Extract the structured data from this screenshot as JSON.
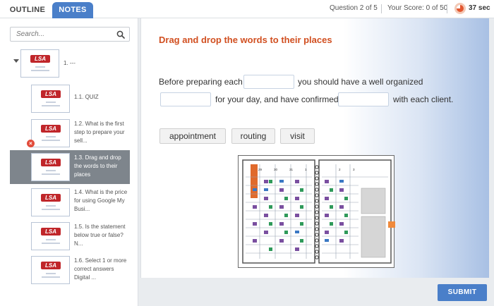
{
  "tabs": {
    "outline": "OUTLINE",
    "notes": "NOTES"
  },
  "status": {
    "question": "Question 2 of 5",
    "score": "Your Score: 0 of 50",
    "timer": "37 sec"
  },
  "search": {
    "placeholder": "Search..."
  },
  "outline": {
    "logo_text": "LSA",
    "items": [
      {
        "label": "1. ---"
      },
      {
        "label": "1.1. QUIZ"
      },
      {
        "label": "1.2. What is the first step to prepare your sell..."
      },
      {
        "label": "1.3. Drag and drop the words to their places"
      },
      {
        "label": "1.4. What is the price for using Google My Busi..."
      },
      {
        "label": "1.5. Is the statement below true or false? N..."
      },
      {
        "label": "1.6. Select 1 or more correct answers Digital ..."
      }
    ],
    "error_badge": "×"
  },
  "slide": {
    "title": "Drag and drop the words to their places",
    "sentence": {
      "part1": "Before preparing each",
      "part2": "you should have a well organized",
      "part3": "for your day, and have confirmed",
      "part4": "with each client."
    },
    "words": [
      "appointment",
      "routing",
      "visit"
    ],
    "planner": {
      "left_page_days": [
        "29",
        "30",
        "31",
        "1"
      ],
      "right_page_days": [
        "2",
        "3"
      ]
    }
  },
  "submit_label": "SUBMIT",
  "colors": {
    "accent": "#4a7fc9",
    "title": "#d14f20",
    "error": "#e24c3b",
    "logo": "#c0262a"
  }
}
